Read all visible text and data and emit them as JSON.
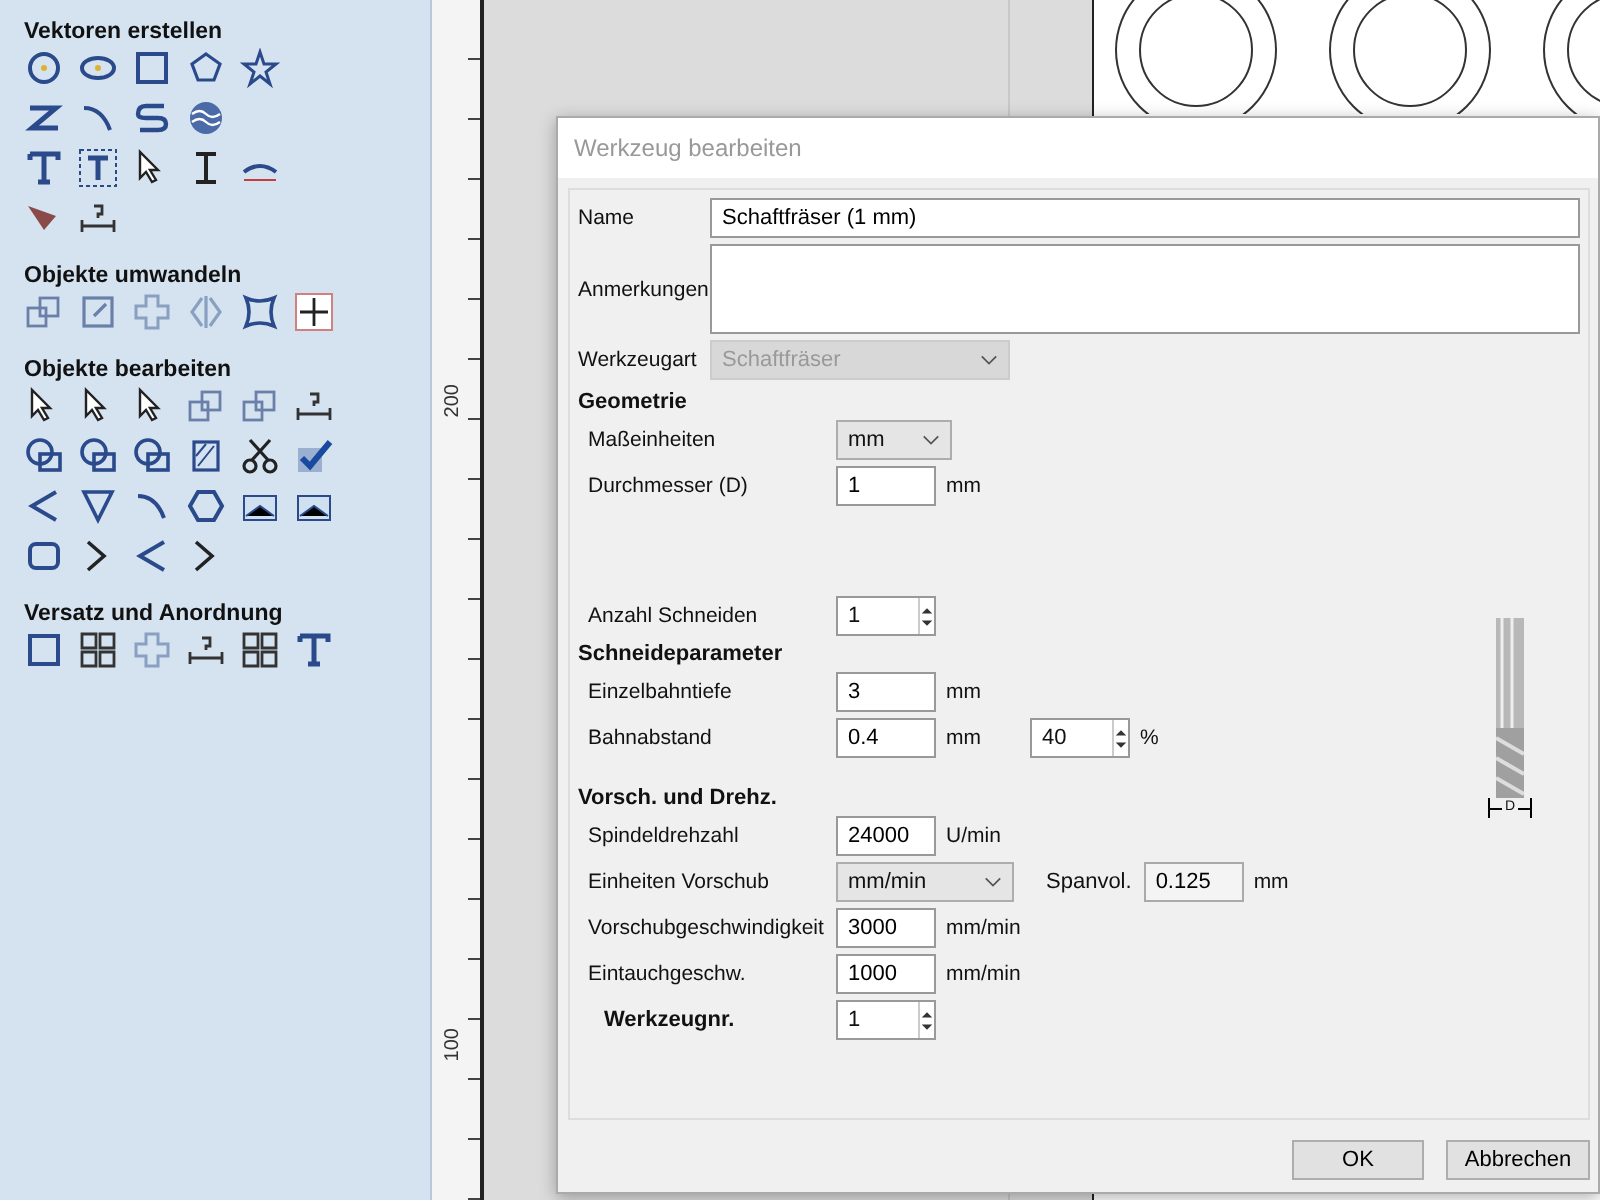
{
  "sidebar": {
    "sections": [
      {
        "title": "Vektoren erstellen"
      },
      {
        "title": "Objekte umwandeln"
      },
      {
        "title": "Objekte  bearbeiten"
      },
      {
        "title": "Versatz und Anordnung"
      }
    ]
  },
  "ruler": {
    "labels": [
      "200",
      "100"
    ]
  },
  "dialog": {
    "title": "Werkzeug bearbeiten",
    "name": {
      "label": "Name",
      "value": "Schaftfräser (1 mm)"
    },
    "notes": {
      "label": "Anmerkungen"
    },
    "tool_type": {
      "label": "Werkzeugart",
      "value": "Schaftfräser",
      "disabled": true
    },
    "sections": [
      {
        "title": "Geometrie",
        "rows": [
          {
            "kind": "dropdown",
            "label": "Maßeinheiten",
            "value": "mm"
          },
          {
            "kind": "input",
            "label": "Durchmesser (D)",
            "value": "1",
            "unit": "mm"
          },
          {
            "kind": "spinner",
            "label": "Anzahl Schneiden",
            "value": "1"
          }
        ]
      },
      {
        "title": "Schneideparameter",
        "rows": [
          {
            "kind": "input",
            "label": "Einzelbahntiefe",
            "value": "3",
            "unit": "mm"
          },
          {
            "kind": "input_percent",
            "label": "Bahnabstand",
            "value": "0.4",
            "unit": "mm",
            "percent_value": "40",
            "percent_unit": "%"
          }
        ]
      },
      {
        "title": "Vorsch. und Drehz.",
        "rows": [
          {
            "kind": "input",
            "label": "Spindeldrehzahl",
            "value": "24000",
            "unit": "U/min"
          },
          {
            "kind": "dropdown_side",
            "label": "Einheiten Vorschub",
            "value": "mm/min",
            "side_label": "Spanvol.",
            "side_value": "0.125",
            "side_unit": "mm"
          },
          {
            "kind": "input",
            "label": "Vorschubgeschwindigkeit",
            "value": "3000",
            "unit": "mm/min"
          },
          {
            "kind": "input",
            "label": "Eintauchgeschw.",
            "value": "1000",
            "unit": "mm/min"
          }
        ]
      }
    ],
    "tool_number": {
      "label": "Werkzeugnr.",
      "value": "1"
    },
    "image_label": "D",
    "buttons": [
      "OK",
      "Abbrechen"
    ]
  }
}
